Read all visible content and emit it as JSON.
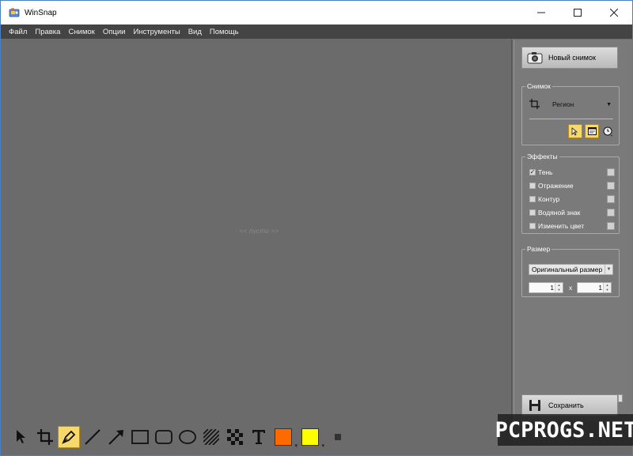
{
  "window": {
    "title": "WinSnap"
  },
  "menu": [
    "Файл",
    "Правка",
    "Снимок",
    "Опции",
    "Инструменты",
    "Вид",
    "Помощь"
  ],
  "canvas": {
    "empty_text": "<< пусто >>"
  },
  "panel": {
    "new_capture_label": "Новый снимок",
    "capture_group": {
      "title": "Снимок",
      "mode": "Регион"
    },
    "effects_group": {
      "title": "Эффекты",
      "items": [
        {
          "label": "Тень",
          "checked": true
        },
        {
          "label": "Отражение",
          "checked": false
        },
        {
          "label": "Контур",
          "checked": false
        },
        {
          "label": "Водяной знак",
          "checked": false
        },
        {
          "label": "Изменить цвет",
          "checked": false
        }
      ]
    },
    "size_group": {
      "title": "Размер",
      "mode": "Оригинальный размер",
      "width": "1",
      "x": "x",
      "height": "1"
    },
    "save_label": "Сохранить"
  },
  "toolbar": {
    "tools": [
      "pointer-icon",
      "crop-icon",
      "pen-icon",
      "line-icon",
      "arrow-icon",
      "rectangle-icon",
      "rounded-rectangle-icon",
      "ellipse-icon",
      "hatch-icon",
      "pixelate-icon",
      "text-icon"
    ],
    "active_tool": "pen-icon",
    "colors": {
      "primary": "#ff6a00",
      "secondary": "#ffff00"
    }
  },
  "watermark": "PCPROGS.NET"
}
